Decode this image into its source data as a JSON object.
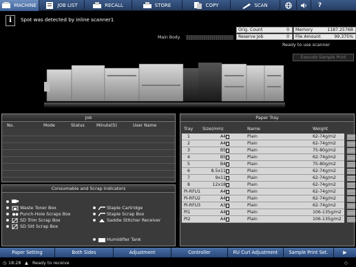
{
  "tabs": [
    {
      "label": "MACHINE",
      "icon": "machine-icon",
      "active": true
    },
    {
      "label": "JOB LIST",
      "icon": "list-icon"
    },
    {
      "label": "RECALL",
      "icon": "recall-icon"
    },
    {
      "label": "STORE",
      "icon": "store-icon"
    },
    {
      "label": "COPY",
      "icon": "copy-icon"
    },
    {
      "label": "SCAN",
      "icon": "scan-icon"
    }
  ],
  "message": "Spot was detected by inline scanner1",
  "main_body_label": "Main Body",
  "counters": {
    "orig_count_label": "Orig. Count",
    "orig_count": "0",
    "reserve_job_label": "Reserve Job",
    "reserve_job": "0",
    "memory_label": "Memory",
    "memory": "1187.2576B",
    "file_amount_label": "File Amount",
    "file_amount": "99.375%"
  },
  "ready_text": "Ready to use scanner",
  "execute_button": "Execute Sample Print",
  "job": {
    "title": "Job",
    "columns": [
      "No.",
      "Mode",
      "Status",
      "Minute(S)",
      "User Name"
    ]
  },
  "consumables": {
    "title": "Consumable and Scrap Indicators",
    "items": [
      "Waste Toner Box",
      "Punch-Hole Scraps Box",
      "SD Trim Scrap Box",
      "SD Slit Scrap Box",
      "Staple Cartridge",
      "Staple Scrap Box",
      "Saddle Stitcher Receiver",
      "Humidifier Tank"
    ]
  },
  "paper_tray": {
    "title": "Paper Tray",
    "columns": [
      "Tray",
      "Size(mm)",
      "Name",
      "Weight"
    ],
    "rows": [
      {
        "tray": "1",
        "size": "A4",
        "name": "Plain",
        "weight": "62-74g/m2"
      },
      {
        "tray": "2",
        "size": "A4",
        "name": "Plain",
        "weight": "62-74g/m2"
      },
      {
        "tray": "3",
        "size": "B5",
        "name": "Plain",
        "weight": "75-80g/m2"
      },
      {
        "tray": "4",
        "size": "B5",
        "name": "Plain",
        "weight": "62-74g/m2"
      },
      {
        "tray": "5",
        "size": "B4",
        "name": "Plain",
        "weight": "75-80g/m2"
      },
      {
        "tray": "6",
        "size": "8.5x11",
        "name": "Plain",
        "weight": "62-74g/m2"
      },
      {
        "tray": "7",
        "size": "9x11",
        "name": "Plain",
        "weight": "62-74g/m2"
      },
      {
        "tray": "8",
        "size": "12x18",
        "name": "Plain",
        "weight": "62-74g/m2"
      },
      {
        "tray": "PI-RFU1",
        "size": "A4",
        "name": "Plain",
        "weight": "62-74g/m2"
      },
      {
        "tray": "PI-RFU2",
        "size": "A4",
        "name": "Plain",
        "weight": "62-74g/m2"
      },
      {
        "tray": "PI-RFU3",
        "size": "A3",
        "name": "Plain",
        "weight": "62-74g/m2"
      },
      {
        "tray": "PI1",
        "size": "A4",
        "name": "Plain",
        "weight": "106-135g/m2"
      },
      {
        "tray": "PI2",
        "size": "A4",
        "name": "Plain",
        "weight": "106-135g/m2"
      }
    ]
  },
  "bottom_buttons": [
    "Paper Setting",
    "Both Sides",
    "Adjustment",
    "Controller",
    "RU Curl Adjustment",
    "Sample Print Set."
  ],
  "status": {
    "time": "18:28",
    "text": "Ready to receive"
  }
}
